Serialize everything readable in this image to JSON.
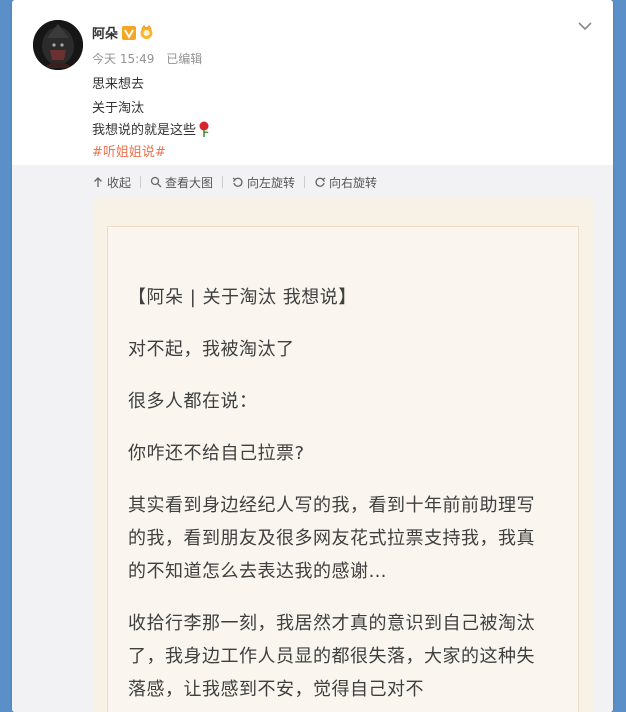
{
  "post": {
    "username": "阿朵",
    "time": "今天 15:49",
    "edited": "已编辑",
    "lines": [
      "思来想去",
      "关于淘汰",
      "我想说的就是这些"
    ],
    "hashtag": "#听姐姐说#"
  },
  "toolbar": {
    "collapse": "收起",
    "view_large": "查看大图",
    "rotate_left": "向左旋转",
    "rotate_right": "向右旋转"
  },
  "article": {
    "title": "【阿朵 | 关于淘汰 我想说】",
    "paragraphs": [
      "对不起，我被淘汰了",
      "很多人都在说：",
      "你咋还不给自己拉票?",
      "其实看到身边经纪人写的我，看到十年前前助理写的我，看到朋友及很多网友花式拉票支持我，我真的不知道怎么去表达我的感谢…",
      "收拾行李那一刻，我居然才真的意识到自己被淘汰了，我身边工作人员显的都很失落，大家的这种失落感，让我感到不安，觉得自己对不"
    ]
  },
  "colors": {
    "hashtag": "#eb7350",
    "verified": "#f5a623",
    "page_bg": "#5b8fc7"
  }
}
